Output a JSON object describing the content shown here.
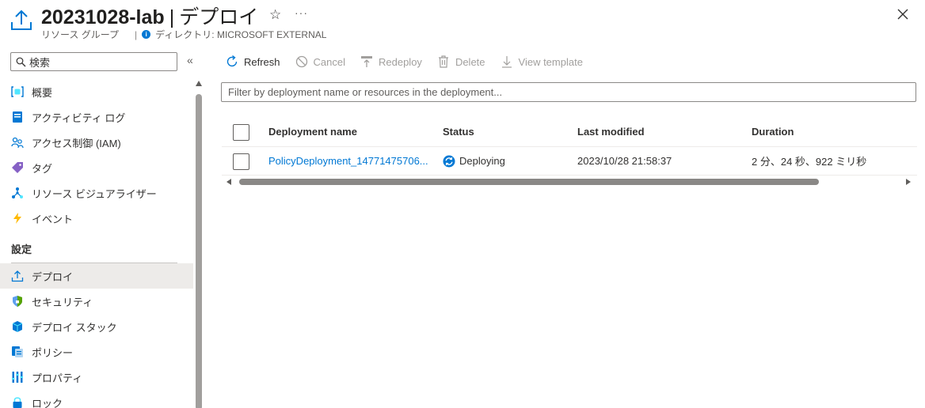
{
  "header": {
    "resource_name": "20231028-lab",
    "separator": "|",
    "page_name": "デプロイ",
    "resource_type": "リソース グループ",
    "directory_label": "ディレクトリ: MICROSOFT EXTERNAL",
    "star_glyph": "☆",
    "more_glyph": "···"
  },
  "sidebar": {
    "search_placeholder": "検索",
    "collapse_glyph": "«",
    "items": [
      {
        "label": "概要",
        "icon": "resource-group-icon"
      },
      {
        "label": "アクティビティ ログ",
        "icon": "activity-log-icon"
      },
      {
        "label": "アクセス制御 (IAM)",
        "icon": "people-icon"
      },
      {
        "label": "タグ",
        "icon": "tag-icon"
      },
      {
        "label": "リソース ビジュアライザー",
        "icon": "visualizer-icon"
      },
      {
        "label": "イベント",
        "icon": "lightning-icon"
      }
    ],
    "section_label": "設定",
    "settings_items": [
      {
        "label": "デプロイ",
        "icon": "upload-icon",
        "active": true
      },
      {
        "label": "セキュリティ",
        "icon": "shield-icon"
      },
      {
        "label": "デプロイ スタック",
        "icon": "stack-icon"
      },
      {
        "label": "ポリシー",
        "icon": "policy-icon"
      },
      {
        "label": "プロパティ",
        "icon": "properties-icon"
      },
      {
        "label": "ロック",
        "icon": "lock-icon"
      }
    ]
  },
  "toolbar": {
    "refresh": "Refresh",
    "cancel": "Cancel",
    "redeploy": "Redeploy",
    "delete": "Delete",
    "view_template": "View template"
  },
  "filter": {
    "placeholder": "Filter by deployment name or resources in the deployment..."
  },
  "table": {
    "columns": {
      "name": "Deployment name",
      "status": "Status",
      "modified": "Last modified",
      "duration": "Duration"
    },
    "rows": [
      {
        "name": "PolicyDeployment_14771475706...",
        "status": "Deploying",
        "modified": "2023/10/28 21:58:37",
        "duration": "2 分、24 秒、922 ミリ秒"
      }
    ]
  },
  "colors": {
    "accent": "#0078d4",
    "disabled_text": "#a19f9d",
    "active_nav_bg": "#edebe9"
  }
}
